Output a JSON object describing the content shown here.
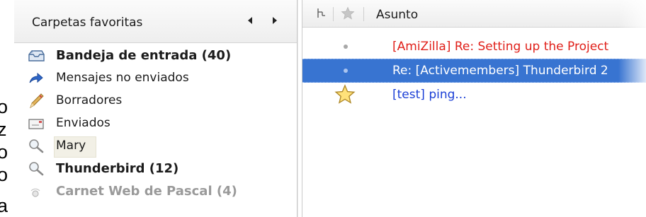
{
  "background_letters": [
    "o",
    "z",
    "o",
    "o",
    "a"
  ],
  "folder_pane": {
    "title": "Carpetas favoritas",
    "items": [
      {
        "label": "Bandeja de entrada (40)",
        "icon": "inbox-icon",
        "bold": true
      },
      {
        "label": "Mensajes no enviados",
        "icon": "unsent-arrow-icon",
        "bold": false
      },
      {
        "label": "Borradores",
        "icon": "drafts-pencil-icon",
        "bold": false
      },
      {
        "label": "Enviados",
        "icon": "sent-envelope-icon",
        "bold": false
      },
      {
        "label": "Mary",
        "icon": "saved-search-icon",
        "bold": false,
        "selected": true
      },
      {
        "label": "Thunderbird (12)",
        "icon": "saved-search-icon",
        "bold": true
      },
      {
        "label": "Carnet Web de Pascal (4)",
        "icon": "feed-icon",
        "bold": true,
        "faded": true
      }
    ]
  },
  "message_pane": {
    "columns": {
      "thread": "thread-icon",
      "star": "star-icon",
      "subject": "Asunto"
    },
    "rows": [
      {
        "subject": "[AmiZilla] Re: Setting up the Project",
        "style": "red",
        "color": "#e0201a"
      },
      {
        "subject": "Re: [Activemembers] Thunderbird 2",
        "style": "selected",
        "color": "#ffffff"
      },
      {
        "subject": "[test] ping...",
        "style": "blue",
        "color": "#1b3fd6",
        "starred": true
      }
    ]
  },
  "colors": {
    "selection": "#3874d1",
    "link_blue": "#1b3fd6",
    "alert_red": "#e0201a"
  }
}
